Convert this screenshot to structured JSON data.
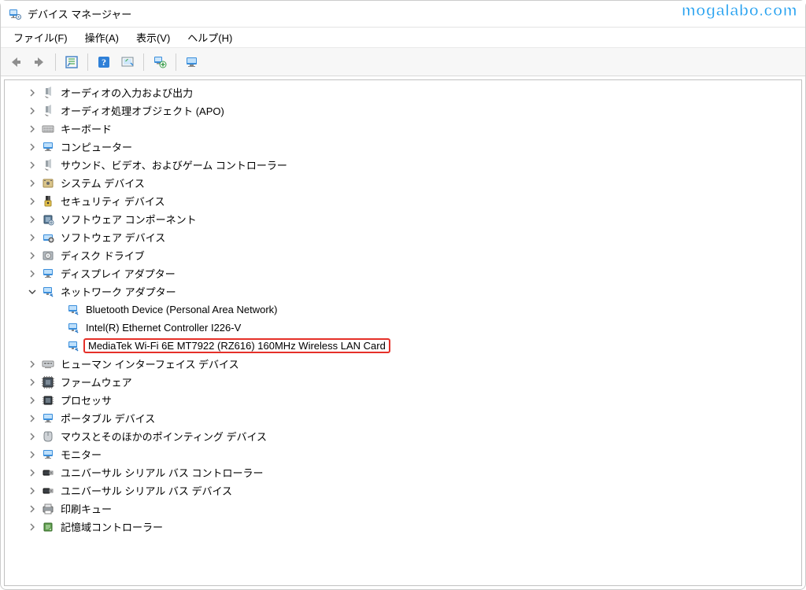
{
  "window": {
    "title": "デバイス マネージャー"
  },
  "watermark": "mogalabo.com",
  "menu": {
    "file": "ファイル(F)",
    "action": "操作(A)",
    "view": "表示(V)",
    "help": "ヘルプ(H)"
  },
  "tree": {
    "items": [
      {
        "icon": "audio-io",
        "label": "オーディオの入力および出力",
        "expandable": true,
        "expanded": false,
        "depth": 1
      },
      {
        "icon": "audio-apo",
        "label": "オーディオ処理オブジェクト (APO)",
        "expandable": true,
        "expanded": false,
        "depth": 1
      },
      {
        "icon": "keyboard",
        "label": "キーボード",
        "expandable": true,
        "expanded": false,
        "depth": 1
      },
      {
        "icon": "computer",
        "label": "コンピューター",
        "expandable": true,
        "expanded": false,
        "depth": 1
      },
      {
        "icon": "svgctrl",
        "label": "サウンド、ビデオ、およびゲーム コントローラー",
        "expandable": true,
        "expanded": false,
        "depth": 1
      },
      {
        "icon": "system",
        "label": "システム デバイス",
        "expandable": true,
        "expanded": false,
        "depth": 1
      },
      {
        "icon": "security",
        "label": "セキュリティ デバイス",
        "expandable": true,
        "expanded": false,
        "depth": 1
      },
      {
        "icon": "swcomp",
        "label": "ソフトウェア コンポーネント",
        "expandable": true,
        "expanded": false,
        "depth": 1
      },
      {
        "icon": "swdev",
        "label": "ソフトウェア デバイス",
        "expandable": true,
        "expanded": false,
        "depth": 1
      },
      {
        "icon": "disk",
        "label": "ディスク ドライブ",
        "expandable": true,
        "expanded": false,
        "depth": 1
      },
      {
        "icon": "display",
        "label": "ディスプレイ アダプター",
        "expandable": true,
        "expanded": false,
        "depth": 1
      },
      {
        "icon": "network",
        "label": "ネットワーク アダプター",
        "expandable": true,
        "expanded": true,
        "depth": 1
      },
      {
        "icon": "net-child",
        "label": "Bluetooth Device (Personal Area Network)",
        "expandable": false,
        "expanded": false,
        "depth": 2
      },
      {
        "icon": "net-child",
        "label": "Intel(R) Ethernet Controller I226-V",
        "expandable": false,
        "expanded": false,
        "depth": 2
      },
      {
        "icon": "net-child",
        "label": "MediaTek Wi-Fi 6E MT7922 (RZ616) 160MHz Wireless LAN Card",
        "expandable": false,
        "expanded": false,
        "depth": 2,
        "highlighted": true
      },
      {
        "icon": "hid",
        "label": "ヒューマン インターフェイス デバイス",
        "expandable": true,
        "expanded": false,
        "depth": 1
      },
      {
        "icon": "firmware",
        "label": "ファームウェア",
        "expandable": true,
        "expanded": false,
        "depth": 1
      },
      {
        "icon": "cpu",
        "label": "プロセッサ",
        "expandable": true,
        "expanded": false,
        "depth": 1
      },
      {
        "icon": "portable",
        "label": "ポータブル デバイス",
        "expandable": true,
        "expanded": false,
        "depth": 1
      },
      {
        "icon": "mouse",
        "label": "マウスとそのほかのポインティング デバイス",
        "expandable": true,
        "expanded": false,
        "depth": 1
      },
      {
        "icon": "monitor",
        "label": "モニター",
        "expandable": true,
        "expanded": false,
        "depth": 1
      },
      {
        "icon": "usbctrl",
        "label": "ユニバーサル シリアル バス コントローラー",
        "expandable": true,
        "expanded": false,
        "depth": 1
      },
      {
        "icon": "usbdev",
        "label": "ユニバーサル シリアル バス デバイス",
        "expandable": true,
        "expanded": false,
        "depth": 1
      },
      {
        "icon": "print",
        "label": "印刷キュー",
        "expandable": true,
        "expanded": false,
        "depth": 1
      },
      {
        "icon": "storage",
        "label": "記憶域コントローラー",
        "expandable": true,
        "expanded": false,
        "depth": 1
      }
    ]
  }
}
